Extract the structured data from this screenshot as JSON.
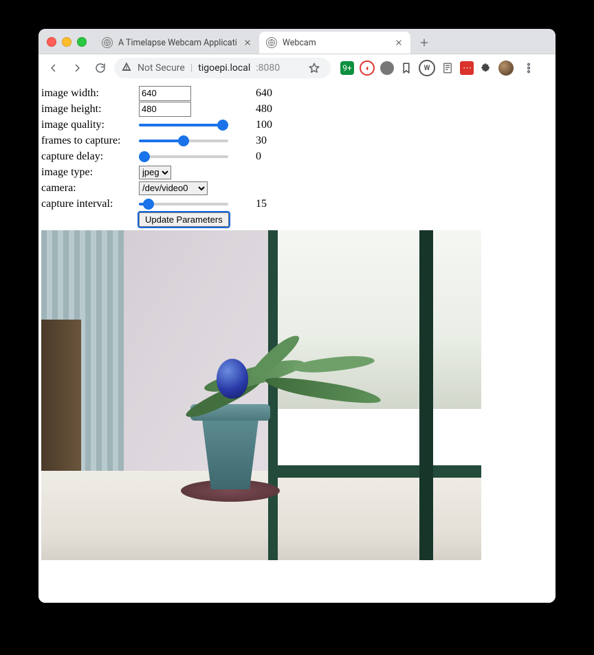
{
  "browser": {
    "tabs": [
      {
        "title": "A Timelapse Webcam Applicati",
        "active": false
      },
      {
        "title": "Webcam",
        "active": true
      }
    ],
    "address": {
      "security_label": "Not Secure",
      "host": "tigoepi.local",
      "port": ":8080"
    }
  },
  "form": {
    "width": {
      "label": "image width:",
      "value": "640",
      "display": "640"
    },
    "height": {
      "label": "image height:",
      "value": "480",
      "display": "480"
    },
    "quality": {
      "label": "image quality:",
      "value": 100,
      "min": 0,
      "max": 100,
      "display": "100"
    },
    "frames": {
      "label": "frames to capture:",
      "value": 30,
      "min": 0,
      "max": 60,
      "display": "30"
    },
    "delay": {
      "label": "capture delay:",
      "value": 0,
      "min": 0,
      "max": 60,
      "display": "0"
    },
    "type": {
      "label": "image type:",
      "selected": "jpeg",
      "options": [
        "jpeg"
      ]
    },
    "camera": {
      "label": "camera:",
      "selected": "/dev/video0",
      "options": [
        "/dev/video0"
      ]
    },
    "interval": {
      "label": "capture interval:",
      "value": 15,
      "min": 0,
      "max": 300,
      "display": "15"
    },
    "submit_label": "Update Parameters"
  }
}
